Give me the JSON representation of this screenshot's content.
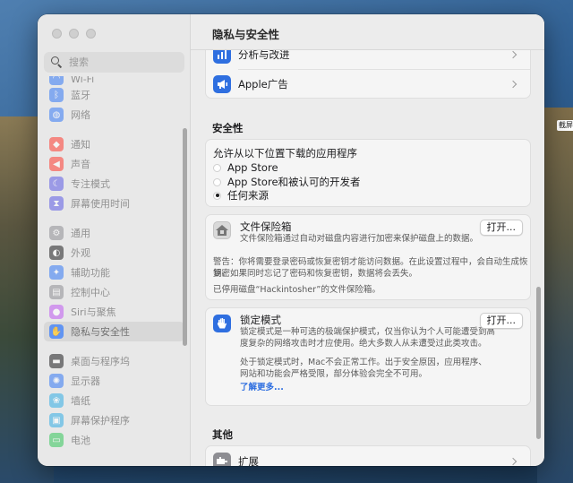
{
  "window": {
    "title": "隐私与安全性"
  },
  "sidebar": {
    "search_placeholder": "搜索",
    "items": [
      {
        "label": "Wi-Fi",
        "color": "#3478f6",
        "icon": "wifi-icon"
      },
      {
        "label": "蓝牙",
        "color": "#3478f6",
        "icon": "bluetooth-icon"
      },
      {
        "label": "网络",
        "color": "#3478f6",
        "icon": "globe-icon"
      },
      {
        "label": "通知",
        "color": "#ff3b30",
        "icon": "bell-icon"
      },
      {
        "label": "声音",
        "color": "#ff3b30",
        "icon": "speaker-icon"
      },
      {
        "label": "专注模式",
        "color": "#5e5ce6",
        "icon": "moon-icon"
      },
      {
        "label": "屏幕使用时间",
        "color": "#5e5ce6",
        "icon": "hourglass-icon"
      },
      {
        "label": "通用",
        "color": "#8e8e93",
        "icon": "gear-icon"
      },
      {
        "label": "外观",
        "color": "#1d1d1f",
        "icon": "appearance-icon"
      },
      {
        "label": "辅助功能",
        "color": "#3478f6",
        "icon": "accessibility-icon"
      },
      {
        "label": "控制中心",
        "color": "#8e8e93",
        "icon": "control-center-icon"
      },
      {
        "label": "Siri与聚焦",
        "color": "#bf5af2",
        "icon": "siri-icon"
      },
      {
        "label": "隐私与安全性",
        "color": "#3478f6",
        "icon": "hand-icon"
      },
      {
        "label": "桌面与程序坞",
        "color": "#1d1d1f",
        "icon": "dock-icon"
      },
      {
        "label": "显示器",
        "color": "#3478f6",
        "icon": "display-icon"
      },
      {
        "label": "墙纸",
        "color": "#32ade6",
        "icon": "wallpaper-icon"
      },
      {
        "label": "屏幕保护程序",
        "color": "#32ade6",
        "icon": "screensaver-icon"
      },
      {
        "label": "电池",
        "color": "#34c759",
        "icon": "battery-icon"
      }
    ]
  },
  "top_rows": {
    "analytics": "分析与改进",
    "apple_ads": "Apple广告"
  },
  "security": {
    "title": "安全性",
    "question": "允许从以下位置下载的应用程序",
    "options": [
      "App Store",
      "App Store和被认可的开发者",
      "任何来源"
    ],
    "selected": "任何来源"
  },
  "filevault": {
    "title": "文件保险箱",
    "description": "文件保险箱通过自动对磁盘内容进行加密来保护磁盘上的数据。",
    "button": "打开...",
    "warning_line1": "警告：你将需要登录密码或恢复密钥才能访问数据。在此设置过程中，会自动生成恢复密",
    "warning_line2": "钥。如果同时忘记了密码和恢复密钥，数据将会丢失。",
    "status": "已停用磁盘“Hackintosher”的文件保险箱。"
  },
  "lockdown": {
    "title": "锁定模式",
    "desc_line1": "锁定模式是一种可选的极端保护模式，仅当你认为个人可能遭受到高",
    "desc_line2": "度复杂的网络攻击时才应使用。绝大多数人从未遭受过此类攻击。",
    "note_line1": "处于锁定模式时，Mac不会正常工作。出于安全原因，应用程序、",
    "note_line2": "网站和功能会严格受限，部分体验会完全不可用。",
    "learn_more": "了解更多...",
    "button": "打开..."
  },
  "other": {
    "title": "其他",
    "extensions": "扩展"
  },
  "desktop": {
    "label": "截屏"
  }
}
